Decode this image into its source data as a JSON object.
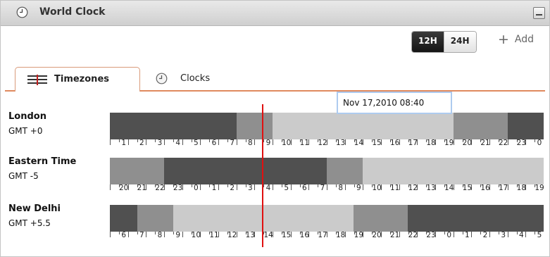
{
  "widget": {
    "title": "World Clock",
    "title_icon": "clock-icon",
    "collapse_icon": "minimize-icon"
  },
  "toolbar": {
    "format_12h": "12H",
    "format_24h": "24H",
    "active_format": "12H",
    "add_label": "Add",
    "add_icon": "plus-icon"
  },
  "tabs": [
    {
      "label": "Timezones",
      "icon": "timezones-icon",
      "active": true
    },
    {
      "label": "Clocks",
      "icon": "clock-icon",
      "active": false
    }
  ],
  "hover": {
    "text": "Nov 17,2010 08:40"
  },
  "colors": {
    "night": "#505050",
    "twilight": "#8f8f8f",
    "day": "#cbcbcb",
    "now_line": "#e01010",
    "tab_accent": "#e08a5e"
  },
  "timezones": [
    {
      "name": "London",
      "offset": "GMT +0",
      "hours": [
        "1",
        "2",
        "3",
        "4",
        "5",
        "6",
        "7",
        "8",
        "9",
        "10",
        "11",
        "12",
        "13",
        "14",
        "15",
        "16",
        "17",
        "18",
        "19",
        "20",
        "21",
        "22",
        "23",
        "0"
      ],
      "segments": [
        {
          "shade": "night",
          "hours": 7
        },
        {
          "shade": "dawn",
          "hours": 2
        },
        {
          "shade": "day",
          "hours": 10
        },
        {
          "shade": "dawn",
          "hours": 3
        },
        {
          "shade": "night",
          "hours": 2
        }
      ]
    },
    {
      "name": "Eastern Time",
      "offset": "GMT -5",
      "hours": [
        "20",
        "21",
        "22",
        "23",
        "0",
        "1",
        "2",
        "3",
        "4",
        "5",
        "6",
        "7",
        "8",
        "9",
        "10",
        "11",
        "12",
        "13",
        "14",
        "15",
        "16",
        "17",
        "18",
        "19"
      ],
      "segments": [
        {
          "shade": "dawn",
          "hours": 3
        },
        {
          "shade": "night",
          "hours": 9
        },
        {
          "shade": "dawn",
          "hours": 2
        },
        {
          "shade": "day",
          "hours": 10
        }
      ]
    },
    {
      "name": "New Delhi",
      "offset": "GMT +5.5",
      "hours": [
        "6",
        "7",
        "8",
        "9",
        "10",
        "11",
        "12",
        "13",
        "14",
        "15",
        "16",
        "17",
        "18",
        "19",
        "20",
        "21",
        "22",
        "23",
        "0",
        "1",
        "2",
        "3",
        "4",
        "5"
      ],
      "segments": [
        {
          "shade": "night",
          "hours": 1.5
        },
        {
          "shade": "dawn",
          "hours": 2
        },
        {
          "shade": "day",
          "hours": 10
        },
        {
          "shade": "dawn",
          "hours": 3
        },
        {
          "shade": "night",
          "hours": 7.5
        }
      ]
    }
  ]
}
